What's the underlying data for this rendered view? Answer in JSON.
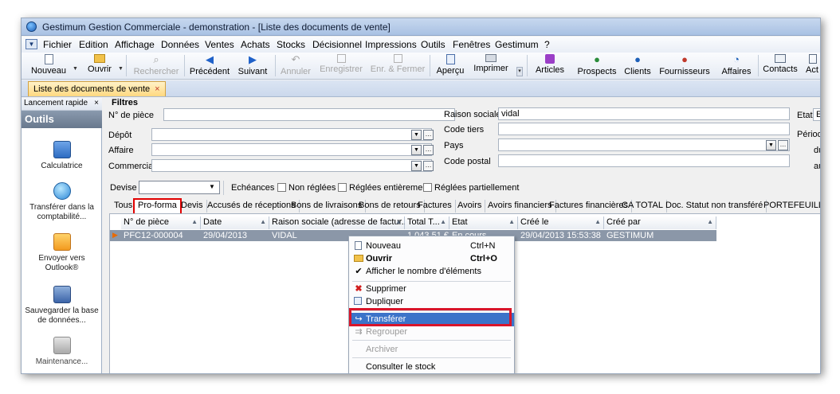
{
  "window": {
    "title": "Gestimum Gestion Commerciale - demonstration - [Liste des documents de vente]"
  },
  "menu": [
    "Fichier",
    "Edition",
    "Affichage",
    "Données",
    "Ventes",
    "Achats",
    "Stocks",
    "Décisionnel",
    "Impressions",
    "Outils",
    "Fenêtres",
    "Gestimum",
    "?"
  ],
  "toolbar": {
    "nouveau": "Nouveau",
    "ouvrir": "Ouvrir",
    "rechercher": "Rechercher",
    "precedent": "Précédent",
    "suivant": "Suivant",
    "annuler": "Annuler",
    "enregistrer": "Enregistrer",
    "enr_fermer": "Enr. & Fermer",
    "apercu": "Aperçu",
    "imprimer": "Imprimer",
    "articles": "Articles",
    "prospects": "Prospects",
    "clients": "Clients",
    "fournisseurs": "Fournisseurs",
    "affaires": "Affaires",
    "contacts": "Contacts",
    "actions": "Act"
  },
  "doc_tab": {
    "label": "Liste des documents de vente",
    "close": "×"
  },
  "sidebar": {
    "header": "Lancement rapide",
    "header_close": "×",
    "section": "Outils",
    "items": [
      {
        "label": "Calculatrice",
        "icon": "calculator-icon"
      },
      {
        "label": "Transférer dans la comptabilité...",
        "icon": "globe-transfer-icon"
      },
      {
        "label": "Envoyer vers Outlook®",
        "icon": "outlook-icon"
      },
      {
        "label": "Sauvegarder la base de données...",
        "icon": "save-database-icon"
      },
      {
        "label": "Maintenance...",
        "icon": "maintenance-tools-icon"
      }
    ]
  },
  "filters": {
    "title": "Filtres",
    "num_piece": {
      "label": "N° de pièce",
      "value": ""
    },
    "depot": {
      "label": "Dépôt",
      "value": ""
    },
    "affaire": {
      "label": "Affaire",
      "value": ""
    },
    "commercial": {
      "label": "Commercial",
      "value": ""
    },
    "raison_sociale": {
      "label": "Raison sociale",
      "value": "vidal"
    },
    "code_tiers": {
      "label": "Code tiers",
      "value": ""
    },
    "pays": {
      "label": "Pays",
      "value": ""
    },
    "code_postal": {
      "label": "Code postal",
      "value": ""
    },
    "etat": {
      "label": "Etat",
      "value": "E"
    },
    "periode": {
      "label": "Périod"
    },
    "du": "du",
    "au": "au",
    "devise": {
      "label": "Devise",
      "value": ""
    },
    "echeances": "Echéances",
    "non_reglees": "Non réglées",
    "reglees_ent": "Réglées entièrement",
    "reglees_part": "Réglées partiellement"
  },
  "grid_tabs": [
    "Tous",
    "Pro-forma",
    "Devis",
    "Accusés de réceptions",
    "Bons de livraisons",
    "Bons de retours",
    "Factures",
    "Avoirs",
    "Avoirs financiers",
    "Factures financières",
    "CA TOTAL",
    "Doc. Statut non transféré",
    "PORTEFEUILLE"
  ],
  "active_tab": "Pro-forma",
  "grid": {
    "columns": [
      "N° de pièce",
      "Date",
      "Raison sociale (adresse de factur...",
      "Total T...",
      "Etat",
      "Créé le",
      "Créé par"
    ],
    "rows": [
      [
        "PFC12-000004",
        "29/04/2013",
        "VIDAL",
        "1 043,51 €",
        "En cours",
        "29/04/2013 15:53:38",
        "GESTIMUM"
      ]
    ]
  },
  "context_menu": [
    {
      "label": "Nouveau",
      "shortcut": "Ctrl+N",
      "icon": "new-document-icon"
    },
    {
      "label": "Ouvrir",
      "shortcut": "Ctrl+O",
      "icon": "open-folder-icon",
      "bold": true
    },
    {
      "label": "Afficher le nombre d'éléments",
      "icon": "check-icon"
    },
    {
      "label": "Supprimer",
      "icon": "delete-x-icon"
    },
    {
      "label": "Dupliquer",
      "icon": "duplicate-icon"
    },
    {
      "label": "Transférer",
      "icon": "transfer-arrow-icon",
      "highlighted": true
    },
    {
      "label": "Regrouper",
      "icon": "group-arrow-icon",
      "disabled": true
    },
    {
      "label": "Archiver",
      "disabled": true
    },
    {
      "label": "Consulter le stock"
    }
  ],
  "colors": {
    "highlight": "#3b73c9",
    "annotation_red": "#d9152a",
    "selected_row": "#8b97a8",
    "tab_active": "#ffd880"
  }
}
